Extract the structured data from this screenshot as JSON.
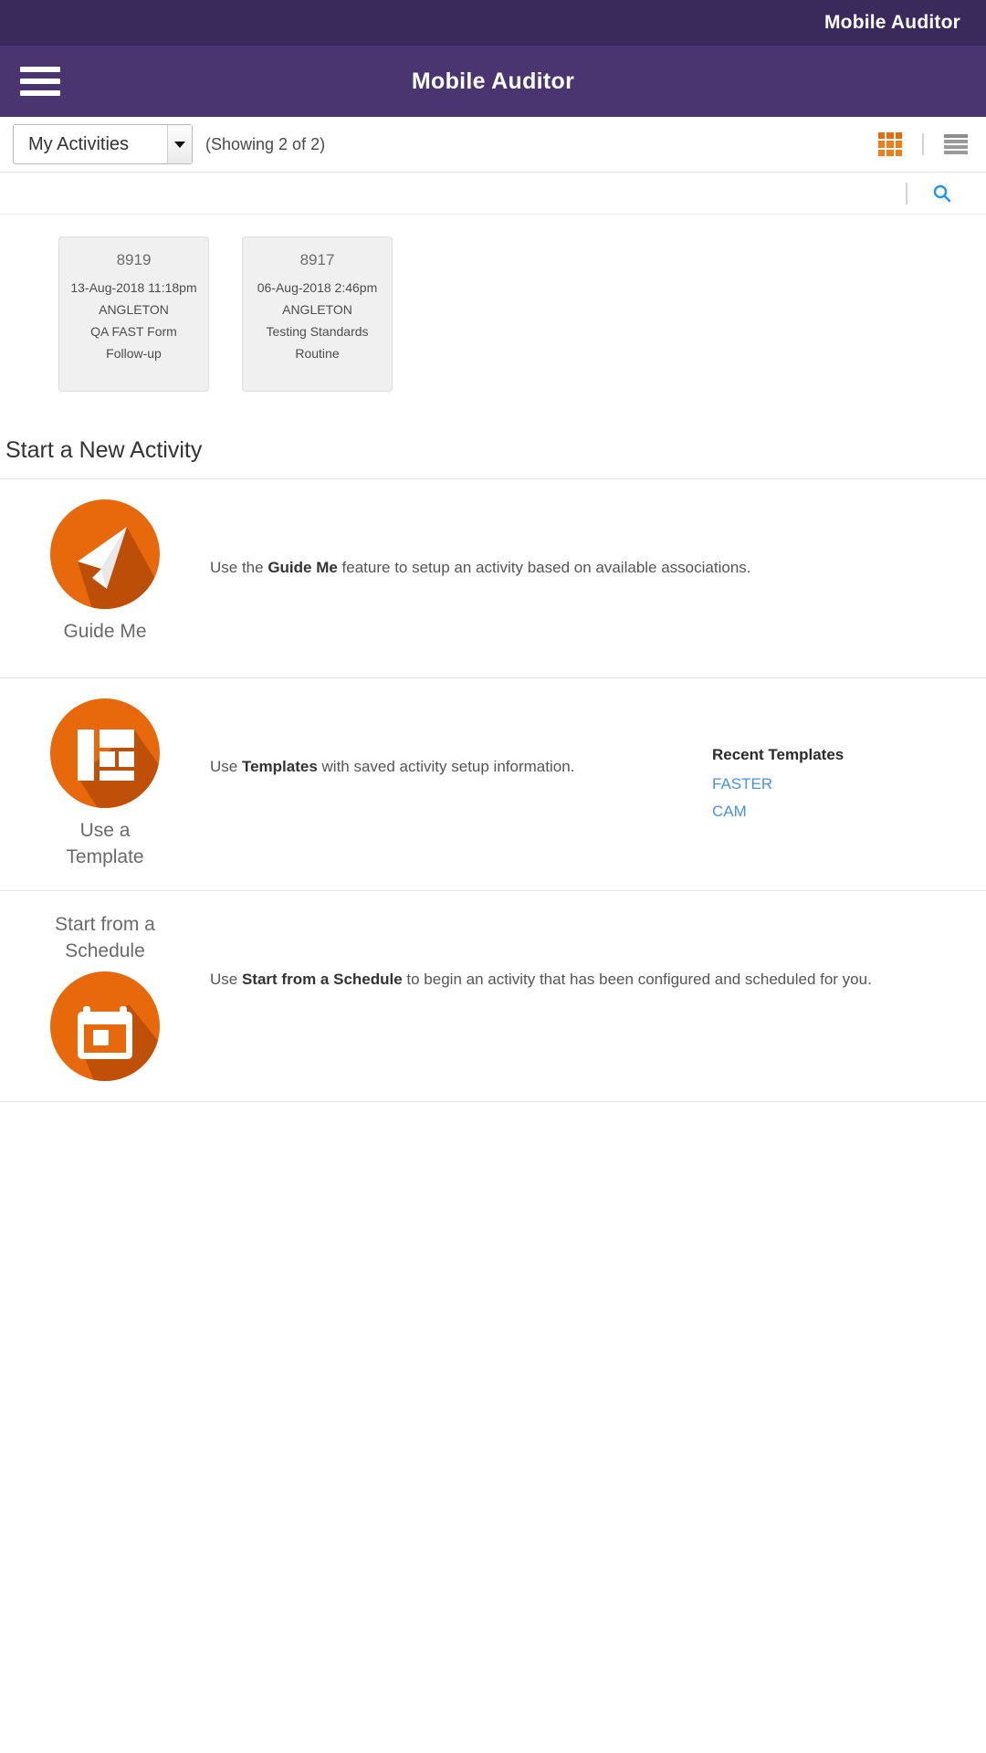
{
  "top_strip": {
    "title": "Mobile Auditor"
  },
  "app_bar": {
    "title": "Mobile Auditor",
    "menu_icon": "hamburger-icon"
  },
  "filter_bar": {
    "selected_filter": "My Activities",
    "filter_options": [
      "My Activities"
    ],
    "showing_text": "(Showing 2 of 2)",
    "grid_view_icon": "grid-view-icon",
    "list_view_icon": "list-view-icon",
    "active_view": "grid"
  },
  "search_row": {
    "search_icon": "search-icon"
  },
  "activities": [
    {
      "id": "8919",
      "datetime": "13-Aug-2018 11:18pm",
      "location": "ANGLETON",
      "form": "QA FAST Form",
      "type": "Follow-up"
    },
    {
      "id": "8917",
      "datetime": "06-Aug-2018 2:46pm",
      "location": "ANGLETON",
      "form": "Testing Standards",
      "type": "Routine"
    }
  ],
  "new_activity": {
    "section_title": "Start a New Activity",
    "guide_me": {
      "label": "Guide Me",
      "icon": "paper-plane-icon",
      "desc_pre": "Use the ",
      "desc_bold": "Guide Me",
      "desc_post": " feature to setup an activity based on available associations."
    },
    "template": {
      "label_line1": "Use a",
      "label_line2": "Template",
      "icon": "layout-grid-icon",
      "desc_pre": "Use ",
      "desc_bold": "Templates",
      "desc_post": " with saved activity setup information.",
      "recent_title": "Recent Templates",
      "recent_items": [
        "FASTER",
        "CAM"
      ]
    },
    "schedule": {
      "label_line1": "Start from a",
      "label_line2": "Schedule",
      "icon": "calendar-icon",
      "desc_pre": "Use ",
      "desc_bold": "Start from a Schedule",
      "desc_post": " to begin an activity that has been configured and scheduled for you."
    }
  },
  "colors": {
    "header_dark": "#3a2a5c",
    "header_light": "#4a3570",
    "accent_orange": "#e8690b",
    "link_blue": "#4a90e2",
    "card_bg": "#f0f0f0"
  }
}
